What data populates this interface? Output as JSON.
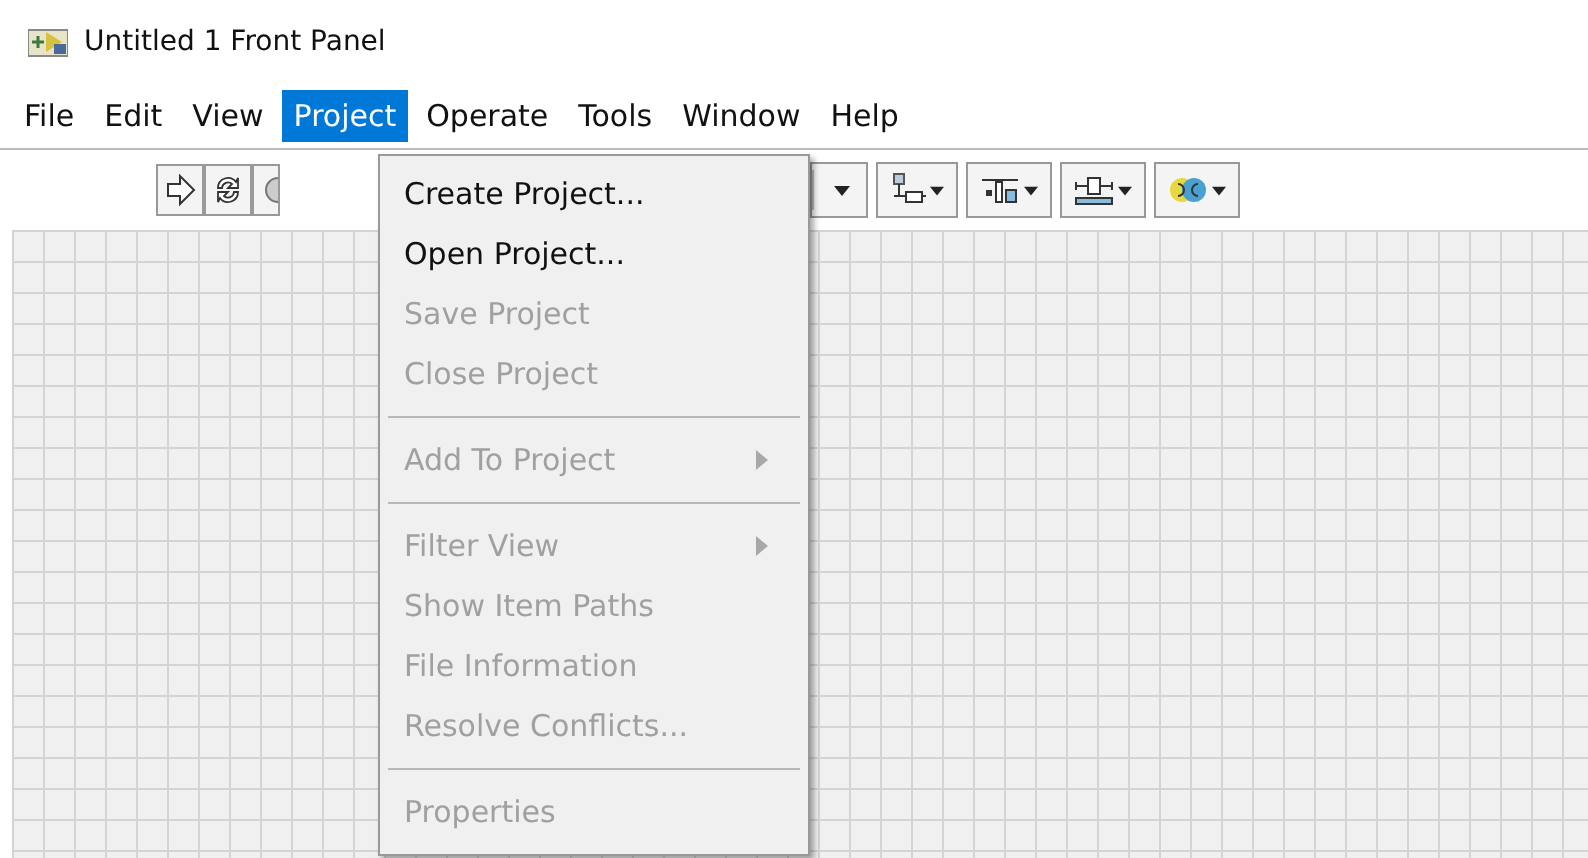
{
  "window": {
    "title": "Untitled 1 Front Panel"
  },
  "menubar": [
    {
      "label": "File",
      "selected": false
    },
    {
      "label": "Edit",
      "selected": false
    },
    {
      "label": "View",
      "selected": false
    },
    {
      "label": "Project",
      "selected": true
    },
    {
      "label": "Operate",
      "selected": false
    },
    {
      "label": "Tools",
      "selected": false
    },
    {
      "label": "Window",
      "selected": false
    },
    {
      "label": "Help",
      "selected": false
    }
  ],
  "menu": [
    {
      "kind": "item",
      "label": "Create Project...",
      "disabled": false,
      "submenu": false
    },
    {
      "kind": "item",
      "label": "Open Project...",
      "disabled": false,
      "submenu": false
    },
    {
      "kind": "item",
      "label": "Save Project",
      "disabled": true,
      "submenu": false
    },
    {
      "kind": "item",
      "label": "Close Project",
      "disabled": true,
      "submenu": false
    },
    {
      "kind": "separator"
    },
    {
      "kind": "item",
      "label": "Add To Project",
      "disabled": true,
      "submenu": true
    },
    {
      "kind": "separator"
    },
    {
      "kind": "item",
      "label": "Filter View",
      "disabled": true,
      "submenu": true
    },
    {
      "kind": "item",
      "label": "Show Item Paths",
      "disabled": true,
      "submenu": false
    },
    {
      "kind": "item",
      "label": "File Information",
      "disabled": true,
      "submenu": false
    },
    {
      "kind": "item",
      "label": "Resolve Conflicts...",
      "disabled": true,
      "submenu": false
    },
    {
      "kind": "separator"
    },
    {
      "kind": "item",
      "label": "Properties",
      "disabled": true,
      "submenu": false
    }
  ]
}
